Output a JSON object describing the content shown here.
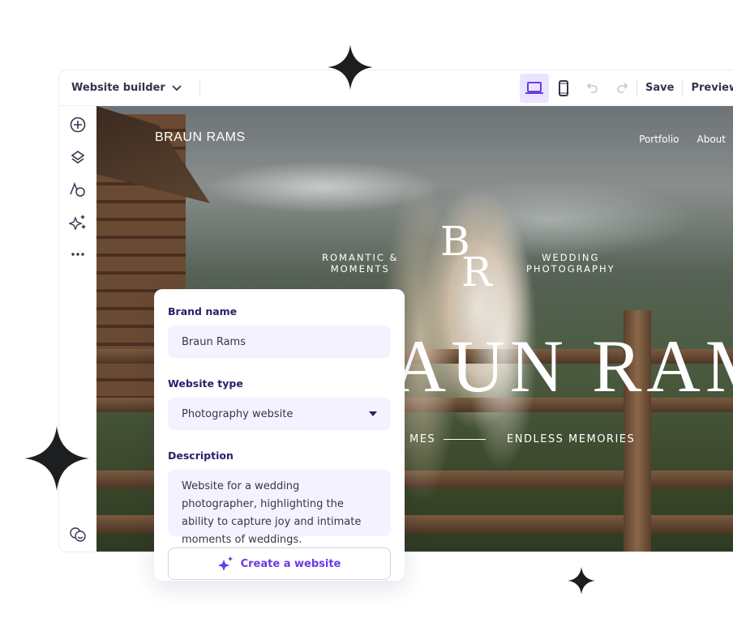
{
  "toolbar": {
    "title": "Website builder",
    "save": "Save",
    "preview": "Preview"
  },
  "sidebar": {
    "icons": [
      "add-icon",
      "layers-icon",
      "typography-palette-icon",
      "ai-sparkle-icon",
      "more-icon",
      "support-icon"
    ]
  },
  "hero": {
    "logo": "BRAUN RAMS",
    "nav": [
      "Portfolio",
      "About"
    ],
    "caption_left": "ROMANTIC &\nMOMENTS",
    "caption_right": "WEDDING\nPHOTOGRAPHY",
    "monogram_top": "B",
    "monogram_bottom": "R",
    "title": "BRAUN RAMS",
    "tagline_left": "MES",
    "tagline_right": "ENDLESS MEMORIES"
  },
  "form": {
    "brand_label": "Brand name",
    "brand_value": "Braun Rams",
    "type_label": "Website type",
    "type_value": "Photography website",
    "desc_label": "Description",
    "desc_value": "Website for a wedding photographer, highlighting the ability to capture joy and intimate moments of weddings.",
    "create": "Create a website"
  },
  "colors": {
    "accent": "#673de6",
    "label": "#2f1c6a",
    "field": "#f4f2ff",
    "active": "#ebe4ff"
  }
}
